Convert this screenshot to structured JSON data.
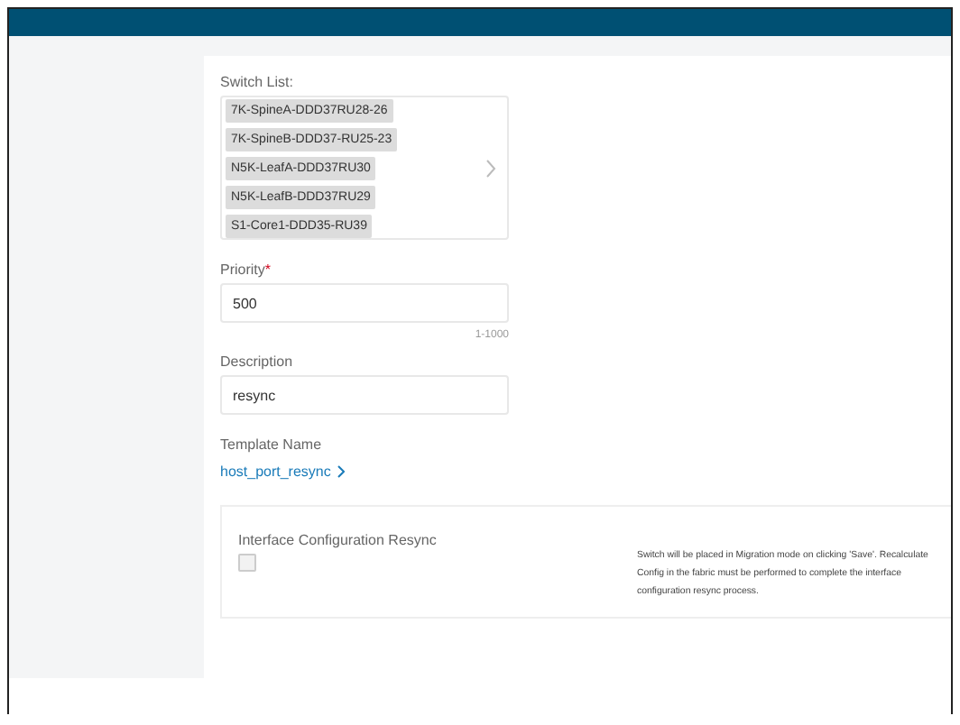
{
  "switch_list": {
    "label": "Switch List:",
    "items": [
      "7K-SpineA-DDD37RU28-26",
      "7K-SpineB-DDD37-RU25-23",
      "N5K-LeafA-DDD37RU30",
      "N5K-LeafB-DDD37RU29",
      "S1-Core1-DDD35-RU39"
    ]
  },
  "priority": {
    "label": "Priority",
    "required_mark": "*",
    "value": "500",
    "hint": "1-1000"
  },
  "description": {
    "label": "Description",
    "value": "resync"
  },
  "template": {
    "label": "Template Name",
    "link": "host_port_resync"
  },
  "resync": {
    "label": "Interface Configuration Resync",
    "checked": false,
    "note": "Switch will be placed in Migration mode on clicking 'Save'. Recalculate Config in the fabric must be performed to complete the interface configuration resync process."
  }
}
